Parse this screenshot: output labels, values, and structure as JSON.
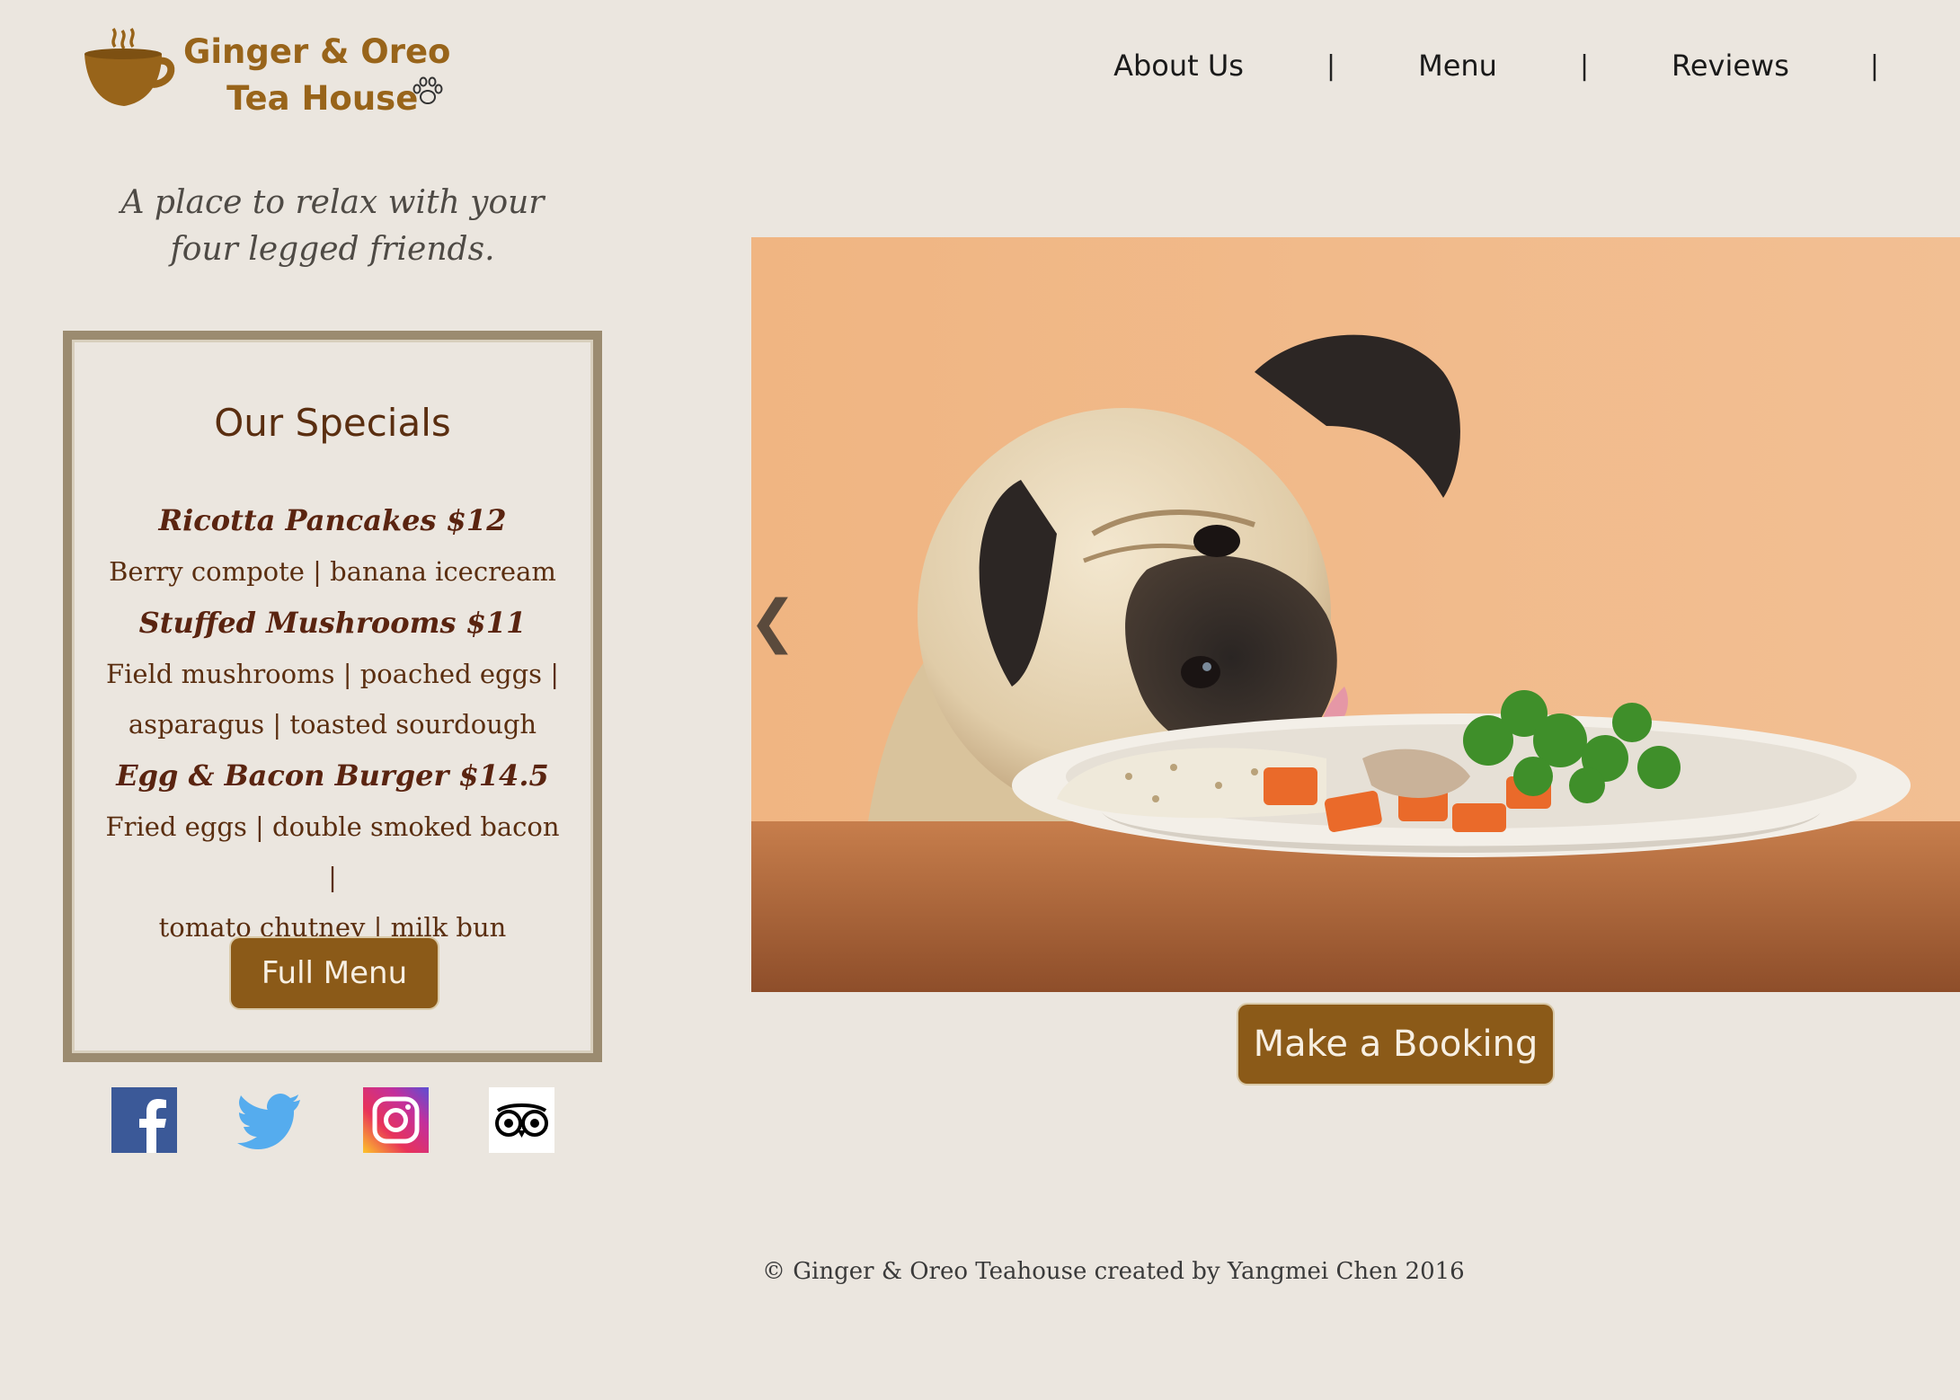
{
  "brand": {
    "name_line1": "Ginger & Oreo",
    "name_line2": "Tea House",
    "color": "#98641a"
  },
  "nav": {
    "items": [
      {
        "label": "About Us"
      },
      {
        "label": "Menu"
      },
      {
        "label": "Reviews"
      }
    ],
    "separator": "|"
  },
  "tagline": {
    "line1": "A place to relax with your",
    "line2": "four legged friends."
  },
  "specials": {
    "title": "Our Specials",
    "items": [
      {
        "name": "Ricotta Pancakes $12",
        "desc_lines": [
          "Berry compote | banana icecream"
        ]
      },
      {
        "name": "Stuffed Mushrooms $11",
        "desc_lines": [
          "Field mushrooms | poached eggs |",
          "asparagus | toasted sourdough"
        ]
      },
      {
        "name": "Egg & Bacon Burger $14.5",
        "desc_lines": [
          "Fried eggs | double smoked bacon |",
          "tomato chutney | milk bun"
        ]
      }
    ],
    "button_label": "Full Menu"
  },
  "social": {
    "icons": [
      "facebook-icon",
      "twitter-icon",
      "instagram-icon",
      "tripadvisor-icon"
    ]
  },
  "hero": {
    "prev_arrow": "❮",
    "booking_label": "Make a Booking"
  },
  "footer": {
    "text": "© Ginger & Oreo Teahouse created by Yangmei Chen 2016"
  },
  "colors": {
    "background": "#ebe6df",
    "accent_button": "#8b5a18",
    "text_brown": "#5a2e10"
  }
}
